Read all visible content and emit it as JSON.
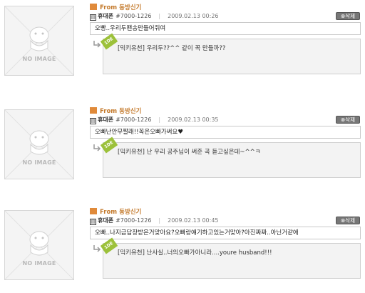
{
  "thumb_label": "NO IMAGE",
  "from_prefix": "From",
  "posts": [
    {
      "from_name": "동방신기",
      "phone_label": "휴대폰",
      "phone_num": "#7000-1226",
      "date": "2009.02.13 00:26",
      "delete_label": "삭제",
      "message": "오빵..우리두팬송만들어줘여",
      "reply_badge": "1DE",
      "reply": "[믹키유천] 우리두??^^ 같이 꼭 만들까??"
    },
    {
      "from_name": "동방신기",
      "phone_label": "휴대폰",
      "phone_num": "#7000-1226",
      "date": "2009.02.13 00:35",
      "delete_label": "삭제",
      "message": "오빠난안무짤래!!꼭은오빠가써요♥",
      "reply_badge": "1DE",
      "reply": "[믹키유천] 난 우리 공주님이 써준 곡 듣고싶은데~^^ㅋ"
    },
    {
      "from_name": "동방신기",
      "phone_label": "휴대폰",
      "phone_num": "#7000-1226",
      "date": "2009.02.13 00:45",
      "delete_label": "삭제",
      "message": "오빠..나지금답장받은거맞아요?오빠랑얘기하고있는거맞아?아진짜짜..아닌거같애",
      "reply_badge": "1DE",
      "reply": "[믹키유천] 난사실..너의오빠가아니라....youre husband!!!"
    }
  ],
  "colors": {
    "from_accent": "#c47a2c",
    "badge_green": "#9cc13a",
    "delete_bg": "#777777",
    "reply_bg": "#f3f3f3"
  }
}
